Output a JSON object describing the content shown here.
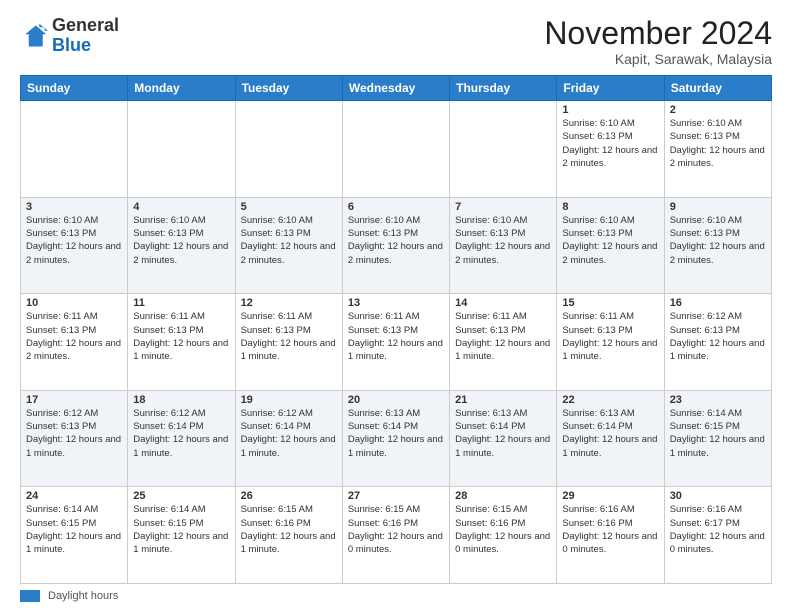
{
  "header": {
    "logo_general": "General",
    "logo_blue": "Blue",
    "month_title": "November 2024",
    "location": "Kapit, Sarawak, Malaysia"
  },
  "footer": {
    "label": "Daylight hours"
  },
  "weekdays": [
    "Sunday",
    "Monday",
    "Tuesday",
    "Wednesday",
    "Thursday",
    "Friday",
    "Saturday"
  ],
  "weeks": [
    [
      {
        "day": "",
        "info": ""
      },
      {
        "day": "",
        "info": ""
      },
      {
        "day": "",
        "info": ""
      },
      {
        "day": "",
        "info": ""
      },
      {
        "day": "",
        "info": ""
      },
      {
        "day": "1",
        "info": "Sunrise: 6:10 AM\nSunset: 6:13 PM\nDaylight: 12 hours and 2 minutes."
      },
      {
        "day": "2",
        "info": "Sunrise: 6:10 AM\nSunset: 6:13 PM\nDaylight: 12 hours and 2 minutes."
      }
    ],
    [
      {
        "day": "3",
        "info": "Sunrise: 6:10 AM\nSunset: 6:13 PM\nDaylight: 12 hours and 2 minutes."
      },
      {
        "day": "4",
        "info": "Sunrise: 6:10 AM\nSunset: 6:13 PM\nDaylight: 12 hours and 2 minutes."
      },
      {
        "day": "5",
        "info": "Sunrise: 6:10 AM\nSunset: 6:13 PM\nDaylight: 12 hours and 2 minutes."
      },
      {
        "day": "6",
        "info": "Sunrise: 6:10 AM\nSunset: 6:13 PM\nDaylight: 12 hours and 2 minutes."
      },
      {
        "day": "7",
        "info": "Sunrise: 6:10 AM\nSunset: 6:13 PM\nDaylight: 12 hours and 2 minutes."
      },
      {
        "day": "8",
        "info": "Sunrise: 6:10 AM\nSunset: 6:13 PM\nDaylight: 12 hours and 2 minutes."
      },
      {
        "day": "9",
        "info": "Sunrise: 6:10 AM\nSunset: 6:13 PM\nDaylight: 12 hours and 2 minutes."
      }
    ],
    [
      {
        "day": "10",
        "info": "Sunrise: 6:11 AM\nSunset: 6:13 PM\nDaylight: 12 hours and 2 minutes."
      },
      {
        "day": "11",
        "info": "Sunrise: 6:11 AM\nSunset: 6:13 PM\nDaylight: 12 hours and 1 minute."
      },
      {
        "day": "12",
        "info": "Sunrise: 6:11 AM\nSunset: 6:13 PM\nDaylight: 12 hours and 1 minute."
      },
      {
        "day": "13",
        "info": "Sunrise: 6:11 AM\nSunset: 6:13 PM\nDaylight: 12 hours and 1 minute."
      },
      {
        "day": "14",
        "info": "Sunrise: 6:11 AM\nSunset: 6:13 PM\nDaylight: 12 hours and 1 minute."
      },
      {
        "day": "15",
        "info": "Sunrise: 6:11 AM\nSunset: 6:13 PM\nDaylight: 12 hours and 1 minute."
      },
      {
        "day": "16",
        "info": "Sunrise: 6:12 AM\nSunset: 6:13 PM\nDaylight: 12 hours and 1 minute."
      }
    ],
    [
      {
        "day": "17",
        "info": "Sunrise: 6:12 AM\nSunset: 6:13 PM\nDaylight: 12 hours and 1 minute."
      },
      {
        "day": "18",
        "info": "Sunrise: 6:12 AM\nSunset: 6:14 PM\nDaylight: 12 hours and 1 minute."
      },
      {
        "day": "19",
        "info": "Sunrise: 6:12 AM\nSunset: 6:14 PM\nDaylight: 12 hours and 1 minute."
      },
      {
        "day": "20",
        "info": "Sunrise: 6:13 AM\nSunset: 6:14 PM\nDaylight: 12 hours and 1 minute."
      },
      {
        "day": "21",
        "info": "Sunrise: 6:13 AM\nSunset: 6:14 PM\nDaylight: 12 hours and 1 minute."
      },
      {
        "day": "22",
        "info": "Sunrise: 6:13 AM\nSunset: 6:14 PM\nDaylight: 12 hours and 1 minute."
      },
      {
        "day": "23",
        "info": "Sunrise: 6:14 AM\nSunset: 6:15 PM\nDaylight: 12 hours and 1 minute."
      }
    ],
    [
      {
        "day": "24",
        "info": "Sunrise: 6:14 AM\nSunset: 6:15 PM\nDaylight: 12 hours and 1 minute."
      },
      {
        "day": "25",
        "info": "Sunrise: 6:14 AM\nSunset: 6:15 PM\nDaylight: 12 hours and 1 minute."
      },
      {
        "day": "26",
        "info": "Sunrise: 6:15 AM\nSunset: 6:16 PM\nDaylight: 12 hours and 1 minute."
      },
      {
        "day": "27",
        "info": "Sunrise: 6:15 AM\nSunset: 6:16 PM\nDaylight: 12 hours and 0 minutes."
      },
      {
        "day": "28",
        "info": "Sunrise: 6:15 AM\nSunset: 6:16 PM\nDaylight: 12 hours and 0 minutes."
      },
      {
        "day": "29",
        "info": "Sunrise: 6:16 AM\nSunset: 6:16 PM\nDaylight: 12 hours and 0 minutes."
      },
      {
        "day": "30",
        "info": "Sunrise: 6:16 AM\nSunset: 6:17 PM\nDaylight: 12 hours and 0 minutes."
      }
    ]
  ]
}
